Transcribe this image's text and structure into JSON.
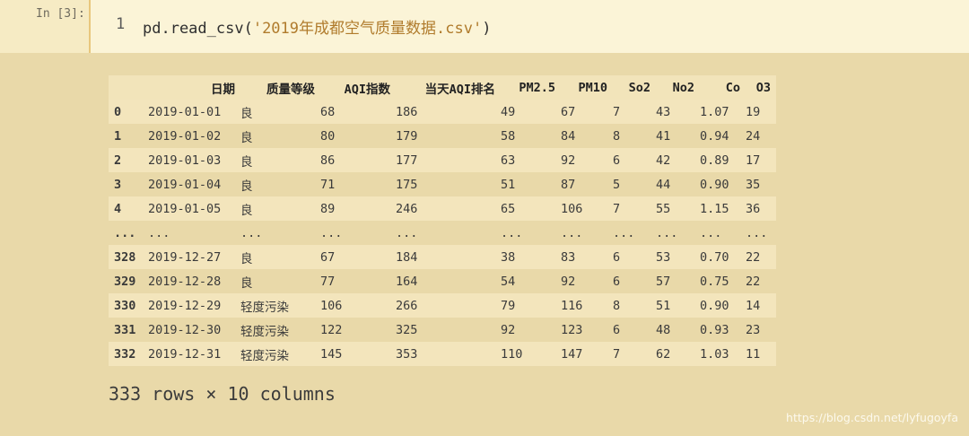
{
  "cell": {
    "prompt": "In [3]:",
    "line_number": "1",
    "code_prefix": "pd.read_csv(",
    "code_string": "'2019年成都空气质量数据.csv'",
    "code_suffix": ")"
  },
  "table": {
    "columns": [
      "",
      "日期",
      "质量等级",
      "AQI指数",
      "当天AQI排名",
      "PM2.5",
      "PM10",
      "So2",
      "No2",
      "Co",
      "O3"
    ],
    "rows": [
      [
        "0",
        "2019-01-01",
        "良",
        "68",
        "186",
        "49",
        "67",
        "7",
        "43",
        "1.07",
        "19"
      ],
      [
        "1",
        "2019-01-02",
        "良",
        "80",
        "179",
        "58",
        "84",
        "8",
        "41",
        "0.94",
        "24"
      ],
      [
        "2",
        "2019-01-03",
        "良",
        "86",
        "177",
        "63",
        "92",
        "6",
        "42",
        "0.89",
        "17"
      ],
      [
        "3",
        "2019-01-04",
        "良",
        "71",
        "175",
        "51",
        "87",
        "5",
        "44",
        "0.90",
        "35"
      ],
      [
        "4",
        "2019-01-05",
        "良",
        "89",
        "246",
        "65",
        "106",
        "7",
        "55",
        "1.15",
        "36"
      ],
      [
        "...",
        "...",
        "...",
        "...",
        "...",
        "...",
        "...",
        "...",
        "...",
        "...",
        "..."
      ],
      [
        "328",
        "2019-12-27",
        "良",
        "67",
        "184",
        "38",
        "83",
        "6",
        "53",
        "0.70",
        "22"
      ],
      [
        "329",
        "2019-12-28",
        "良",
        "77",
        "164",
        "54",
        "92",
        "6",
        "57",
        "0.75",
        "22"
      ],
      [
        "330",
        "2019-12-29",
        "轻度污染",
        "106",
        "266",
        "79",
        "116",
        "8",
        "51",
        "0.90",
        "14"
      ],
      [
        "331",
        "2019-12-30",
        "轻度污染",
        "122",
        "325",
        "92",
        "123",
        "6",
        "48",
        "0.93",
        "23"
      ],
      [
        "332",
        "2019-12-31",
        "轻度污染",
        "145",
        "353",
        "110",
        "147",
        "7",
        "62",
        "1.03",
        "11"
      ]
    ]
  },
  "shape_text": "333 rows × 10 columns",
  "watermark": "https://blog.csdn.net/lyfugoyfa",
  "colors": {
    "page_bg": "#e9d9a9",
    "input_bg": "#fbf4d7",
    "string_color": "#b07b2c"
  }
}
